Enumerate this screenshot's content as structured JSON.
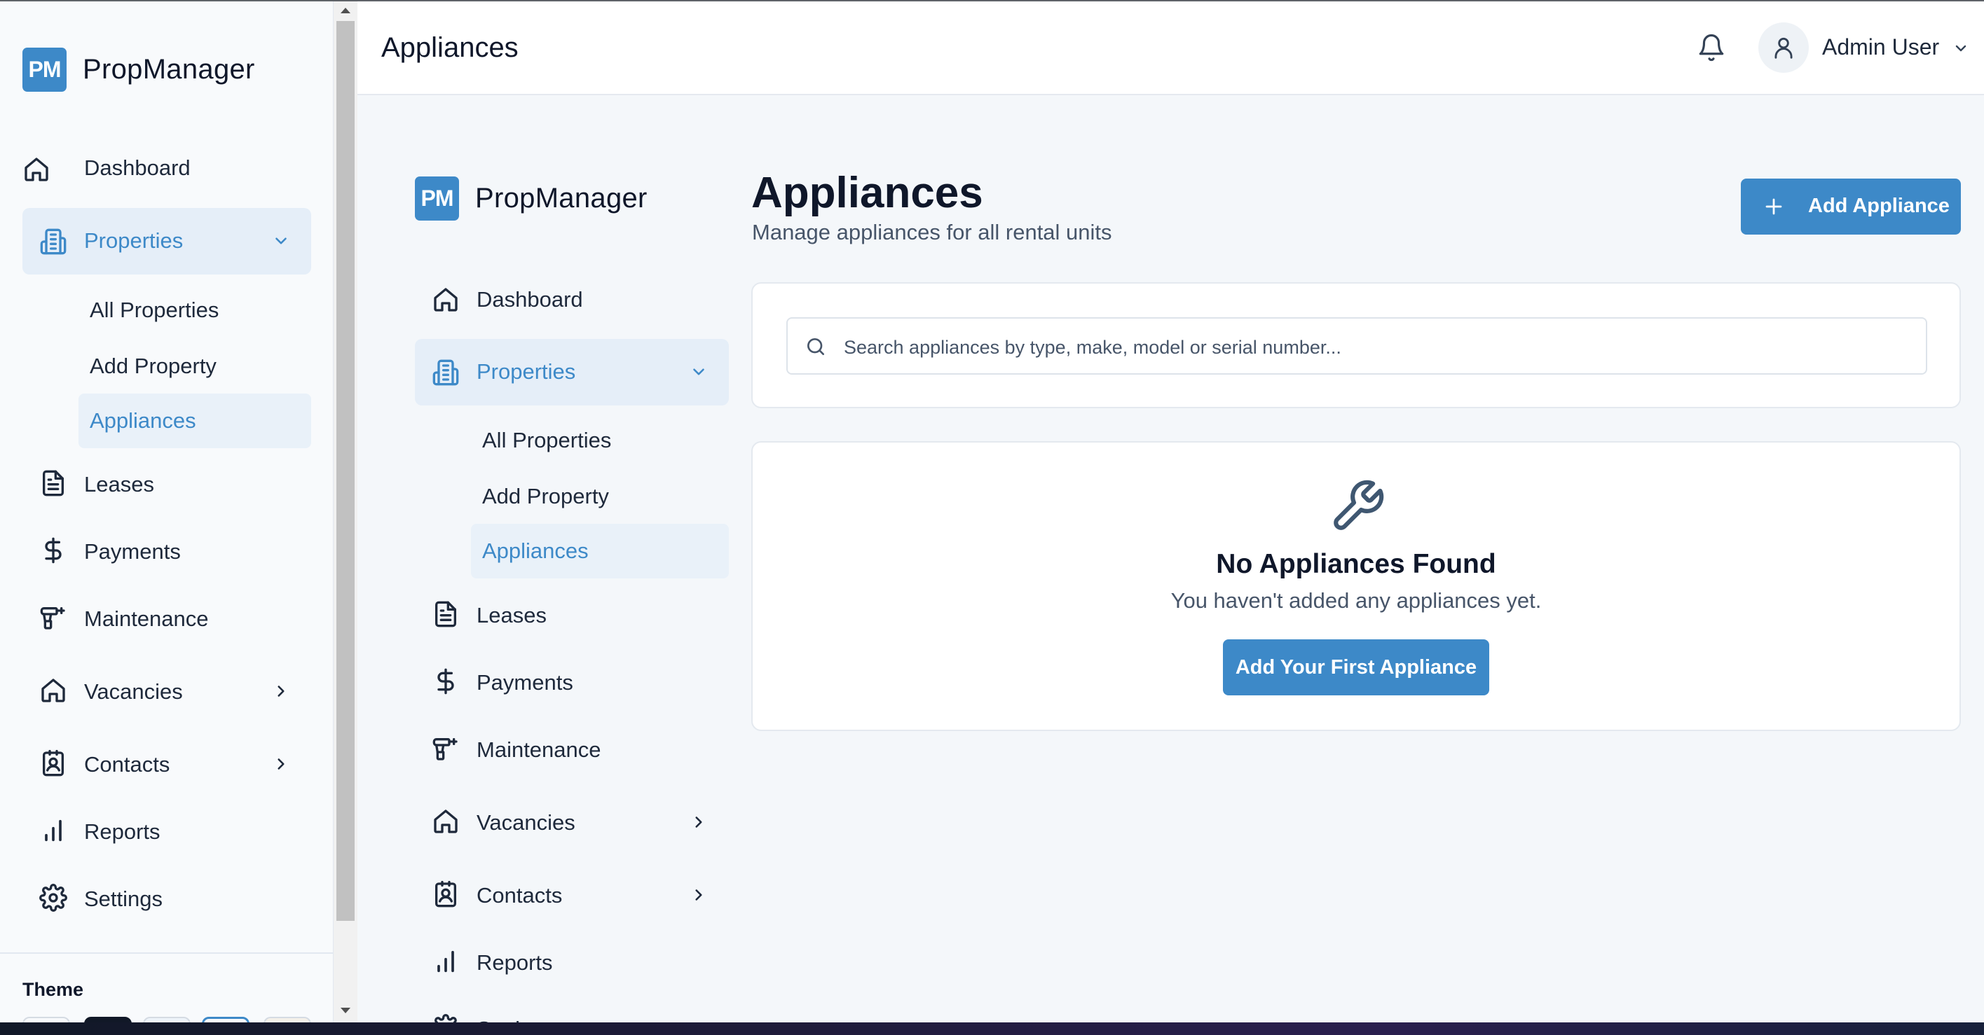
{
  "brand": {
    "logo_text": "PM",
    "name": "PropManager"
  },
  "nav": {
    "dashboard": "Dashboard",
    "properties": "Properties",
    "properties_sub": {
      "all": "All Properties",
      "add": "Add Property",
      "appliances": "Appliances"
    },
    "leases": "Leases",
    "payments": "Payments",
    "maintenance": "Maintenance",
    "vacancies": "Vacancies",
    "contacts": "Contacts",
    "reports": "Reports",
    "settings": "Settings",
    "theme_label": "Theme"
  },
  "header": {
    "title": "Appliances",
    "user_name": "Admin User"
  },
  "page": {
    "title": "Appliances",
    "subtitle": "Manage appliances for all rental units",
    "add_button": "Add Appliance"
  },
  "search": {
    "placeholder": "Search appliances by type, make, model or serial number..."
  },
  "empty_state": {
    "title": "No Appliances Found",
    "text": "You haven't added any appliances yet.",
    "button": "Add Your First Appliance"
  },
  "colors": {
    "accent": "#3d89c8",
    "active_bg": "#e5eef8",
    "text": "#1e293b",
    "muted": "#475569"
  },
  "icons": [
    "home-icon",
    "building-icon",
    "chevron-down-icon",
    "chevron-right-icon",
    "document-icon",
    "dollar-icon",
    "drill-icon",
    "contact-icon",
    "bar-chart-icon",
    "gear-icon",
    "bell-icon",
    "user-icon",
    "plus-icon",
    "search-icon",
    "wrench-icon"
  ]
}
